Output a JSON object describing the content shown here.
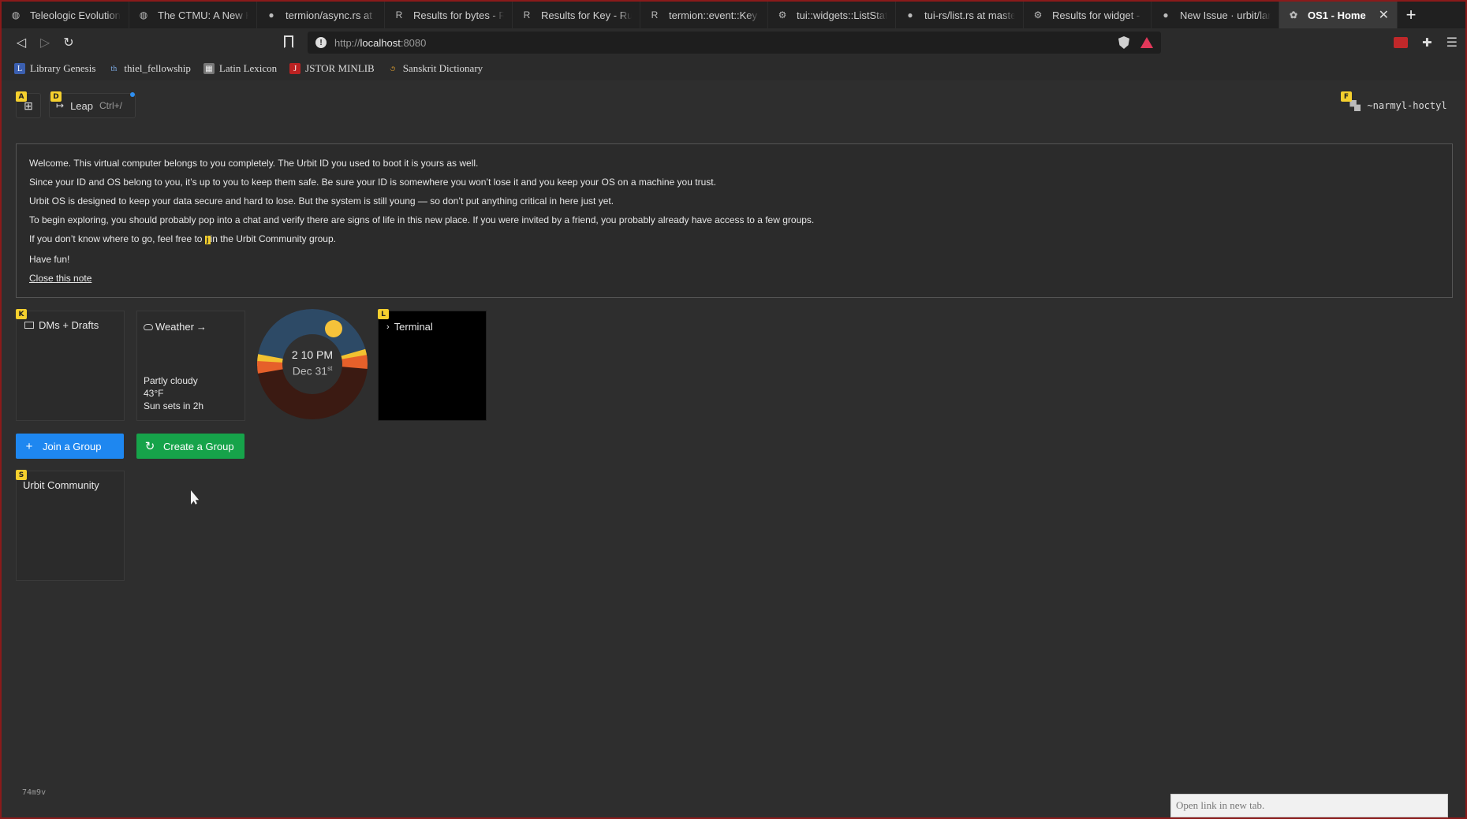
{
  "browser": {
    "tabs": [
      {
        "label": "Teleologic Evolution | C",
        "icon": "globe-icon"
      },
      {
        "label": "The CTMU: A New Kin",
        "icon": "globe-icon"
      },
      {
        "label": "termion/async.rs at ma",
        "icon": "github-icon"
      },
      {
        "label": "Results for bytes - Rust",
        "icon": "rust-icon"
      },
      {
        "label": "Results for Key - Rust",
        "icon": "rust-icon"
      },
      {
        "label": "termion::event::Key - R",
        "icon": "rust-icon"
      },
      {
        "label": "tui::widgets::ListState -",
        "icon": "rust-icon"
      },
      {
        "label": "tui-rs/list.rs at master -",
        "icon": "github-icon"
      },
      {
        "label": "Results for widget - Ru",
        "icon": "rust-icon"
      },
      {
        "label": "New Issue · urbit/land",
        "icon": "github-icon"
      }
    ],
    "active_tab": {
      "label": "OS1 - Home",
      "close": "✕"
    },
    "new_tab": "+",
    "url": {
      "scheme": "http://",
      "host": "localhost",
      "port": ":8080"
    },
    "bookmarks": [
      {
        "label": "Library Genesis",
        "icon": "libgen-icon"
      },
      {
        "label": "thiel_fellowship",
        "icon": "thiel-icon"
      },
      {
        "label": "Latin Lexicon",
        "icon": "lexicon-icon"
      },
      {
        "label": "JSTOR MINLIB",
        "icon": "jstor-icon"
      },
      {
        "label": "Sanskrit Dictionary",
        "icon": "sanskrit-icon"
      }
    ]
  },
  "hints": {
    "apps": "A",
    "leap": "D",
    "user": "F",
    "dms": "K",
    "terminal": "L",
    "community": "S"
  },
  "header": {
    "leap_label": "Leap",
    "leap_shortcut": "Ctrl+/",
    "user": "~narmyl-hoctyl"
  },
  "welcome": {
    "line1": "Welcome. This virtual computer belongs to you completely. The Urbit ID you used to boot it is yours as well.",
    "line2": "Since your ID and OS belong to you, it’s up to you to keep them safe. Be sure your ID is somewhere you won’t lose it and you keep your OS on a machine you trust.",
    "line3": "Urbit OS is designed to keep your data secure and hard to lose. But the system is still young — so don’t put anything critical in here just yet.",
    "line4": "To begin exploring, you should probably pop into a chat and verify there are signs of life in this new place. If you were invited by a friend, you probably already have access to a few groups.",
    "line5_pre": "If you don’t know where to go, feel free to ",
    "line5_hint": "j",
    "line5_post": "in the Urbit Community group.",
    "line6": "Have fun!",
    "close": "Close this note"
  },
  "tiles": {
    "dms": "DMs + Drafts",
    "weather": {
      "title": "Weather",
      "arrow": "→",
      "condition": "Partly cloudy",
      "temp": "43°F",
      "sunset": "Sun sets in 2h"
    },
    "clock": {
      "time": "2 10 PM",
      "date": "Dec 31",
      "suffix": "st"
    },
    "terminal": "Terminal"
  },
  "buttons": {
    "join": "Join a Group",
    "create": "Create a Group"
  },
  "groups": [
    {
      "name": "Urbit Community"
    }
  ],
  "footer": {
    "version": "74m9v",
    "status": "Open link in new tab."
  },
  "colors": {
    "join": "#1e87f0",
    "create": "#16a34a",
    "hint": "#f5d02e",
    "frame": "#8a1a1a"
  }
}
